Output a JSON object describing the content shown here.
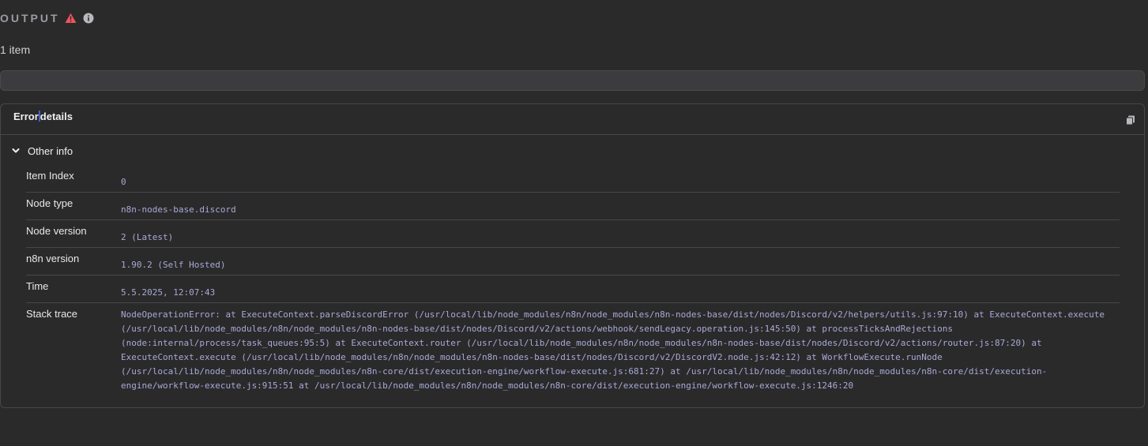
{
  "header": {
    "title": "OUTPUT",
    "warning_icon": "warning-triangle-icon",
    "info_icon": "info-circle-icon",
    "warning_color": "#f0545e",
    "info_color": "#b8b8bd"
  },
  "item_count": "1 item",
  "panel": {
    "title_part1": "Error",
    "title_part2": "details",
    "copy_icon": "copy-icon",
    "section": {
      "label": "Other info",
      "expanded": true
    },
    "rows": [
      {
        "label": "Item Index",
        "value": "0"
      },
      {
        "label": "Node type",
        "value": "n8n-nodes-base.discord"
      },
      {
        "label": "Node version",
        "value": "2 (Latest)"
      },
      {
        "label": "n8n version",
        "value": "1.90.2 (Self Hosted)"
      },
      {
        "label": "Time",
        "value": "5.5.2025, 12:07:43"
      },
      {
        "label": "Stack trace",
        "value": "NodeOperationError: at ExecuteContext.parseDiscordError (/usr/local/lib/node_modules/n8n/node_modules/n8n-nodes-base/dist/nodes/Discord/v2/helpers/utils.js:97:10) at ExecuteContext.execute (/usr/local/lib/node_modules/n8n/node_modules/n8n-nodes-base/dist/nodes/Discord/v2/actions/webhook/sendLegacy.operation.js:145:50) at processTicksAndRejections (node:internal/process/task_queues:95:5) at ExecuteContext.router (/usr/local/lib/node_modules/n8n/node_modules/n8n-nodes-base/dist/nodes/Discord/v2/actions/router.js:87:20) at ExecuteContext.execute (/usr/local/lib/node_modules/n8n/node_modules/n8n-nodes-base/dist/nodes/Discord/v2/DiscordV2.node.js:42:12) at WorkflowExecute.runNode (/usr/local/lib/node_modules/n8n/node_modules/n8n-core/dist/execution-engine/workflow-execute.js:681:27) at /usr/local/lib/node_modules/n8n/node_modules/n8n-core/dist/execution-engine/workflow-execute.js:915:51 at /usr/local/lib/node_modules/n8n/node_modules/n8n-core/dist/execution-engine/workflow-execute.js:1246:20"
      }
    ]
  }
}
